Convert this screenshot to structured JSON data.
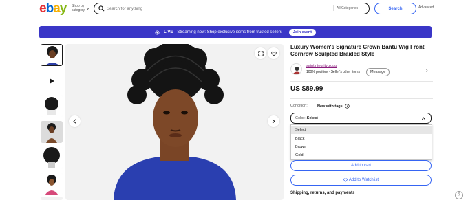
{
  "header": {
    "logo": {
      "e": "e",
      "b": "b",
      "a": "a",
      "y": "y"
    },
    "shop_by_line1": "Shop by",
    "shop_by_line2": "category",
    "search_placeholder": "Search for anything",
    "category": "All Categories",
    "search_button": "Search",
    "advanced": "Advanced"
  },
  "banner": {
    "live": "LIVE",
    "text": "Streaming now: Shop exclusive items from trusted sellers",
    "join": "Join event",
    "bg_color": "#3a36c7"
  },
  "listing": {
    "title": "Luxury Women's Signature Crown Bantu Wig Front Cornrow Sculpted Braided Style",
    "seller": {
      "name": "saintintegritygiopp",
      "positive": "100% positive",
      "other_items": "Seller's other items",
      "message": "Message"
    },
    "price": "US $89.99",
    "condition_label": "Condition:",
    "condition_value": "New with tags",
    "color_label": "Color:",
    "color_value": "Select",
    "color_options": [
      {
        "label": "Select",
        "selected": true
      },
      {
        "label": "Black",
        "selected": false
      },
      {
        "label": "Brown",
        "selected": false
      },
      {
        "label": "Gold",
        "selected": false
      }
    ],
    "add_to_cart": "Add to cart",
    "add_to_watchlist": "Add to Watchlist",
    "shipping": "Shipping, returns, and payments",
    "accent_color": "#3665f3"
  },
  "help": "?"
}
